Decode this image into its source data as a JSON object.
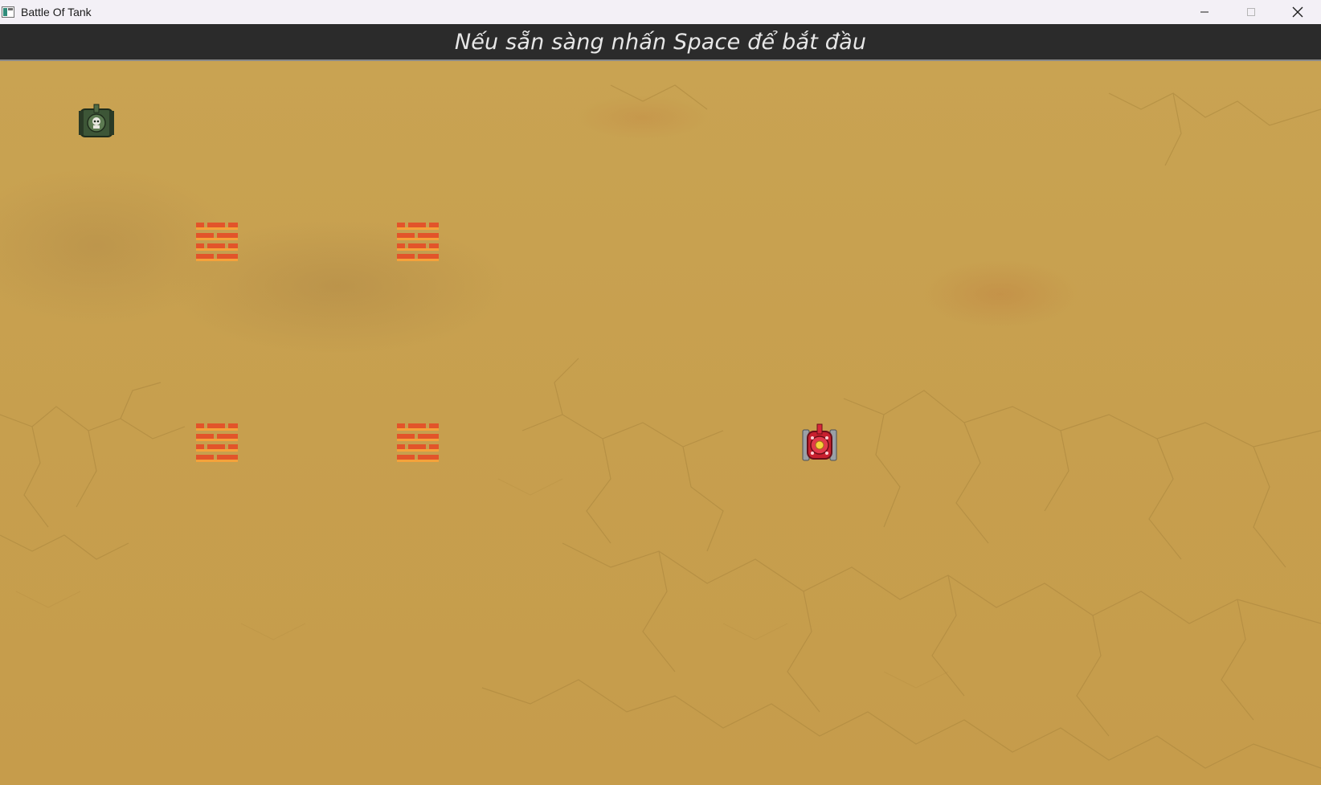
{
  "window": {
    "title": "Battle Of Tank",
    "controls": {
      "minimize_icon": "minimize-icon",
      "maximize_icon": "maximize-icon",
      "close_icon": "close-icon"
    }
  },
  "banner": {
    "message": "Nếu sẵn sàng nhấn Space để bắt đầu"
  },
  "game": {
    "objects": [
      {
        "type": "enemy-tank",
        "icon": "enemy-tank-icon",
        "color": "#4f6b45"
      },
      {
        "type": "brick-wall",
        "icon": "brick-wall-icon",
        "color": "#e2542a"
      },
      {
        "type": "brick-wall",
        "icon": "brick-wall-icon",
        "color": "#e2542a"
      },
      {
        "type": "brick-wall",
        "icon": "brick-wall-icon",
        "color": "#e2542a"
      },
      {
        "type": "brick-wall",
        "icon": "brick-wall-icon",
        "color": "#e2542a"
      },
      {
        "type": "player-tank",
        "icon": "player-tank-icon",
        "color": "#d8283a"
      }
    ],
    "colors": {
      "ground": "#c79f4e",
      "banner_bg": "#2b2b2b"
    }
  }
}
